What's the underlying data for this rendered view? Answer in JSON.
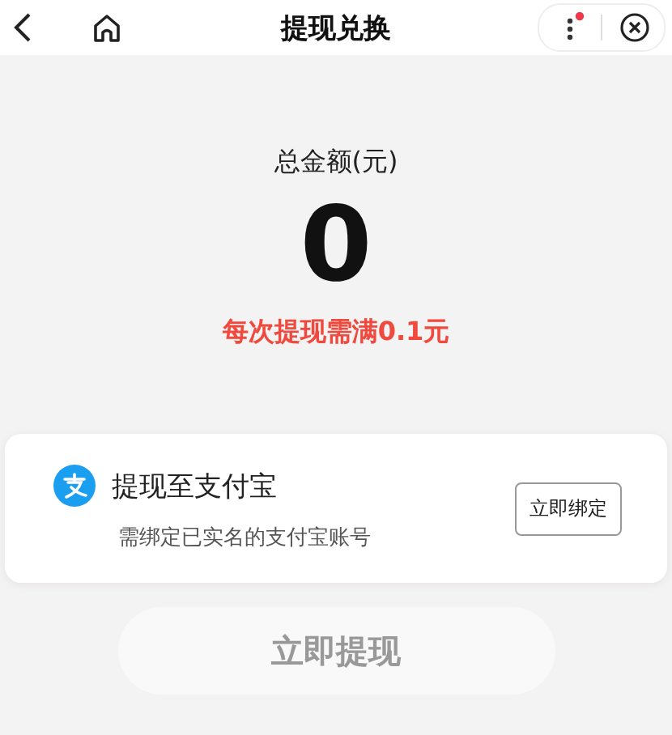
{
  "nav": {
    "title": "提现兑换",
    "menu_badge": true
  },
  "summary": {
    "label": "总金额(元)",
    "amount": "0",
    "notice": "每次提现需满0.1元"
  },
  "method": {
    "title": "提现至支付宝",
    "subtitle": "需绑定已实名的支付宝账号",
    "button": "立即绑定"
  },
  "submit": {
    "label": "立即提现",
    "disabled": true
  }
}
